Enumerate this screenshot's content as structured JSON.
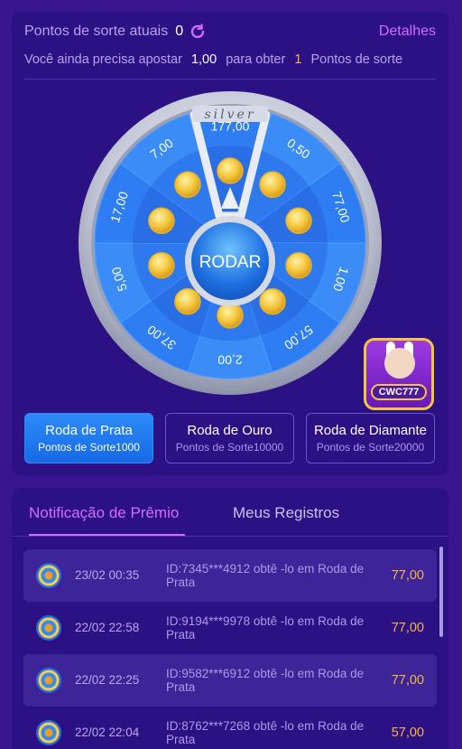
{
  "header": {
    "luck_points_label": "Pontos de sorte atuais",
    "luck_points_value": "0",
    "details_link": "Detalhes",
    "bet_prefix": "Você ainda precisa apostar",
    "bet_amount": "1,00",
    "bet_middle": "para obter",
    "points_amount": "1",
    "points_suffix": "Pontos de sorte"
  },
  "wheel": {
    "tier_label": "silver",
    "spin_label": "RODAR",
    "prizes": [
      "177,00",
      "0,50",
      "77,00",
      "1,00",
      "57,00",
      "2,00",
      "37,00",
      "5,00",
      "17,00",
      "7,00"
    ]
  },
  "logo": {
    "text": "CWC777"
  },
  "wheel_tabs": [
    {
      "title": "Roda de Prata",
      "subtitle": "Pontos de Sorte1000",
      "active": true
    },
    {
      "title": "Roda de Ouro",
      "subtitle": "Pontos de Sorte10000",
      "active": false
    },
    {
      "title": "Roda de Diamante",
      "subtitle": "Pontos de Sorte20000",
      "active": false
    }
  ],
  "records_tabs": {
    "notifications": "Notificação de Prêmio",
    "my_records": "Meus Registros"
  },
  "records": [
    {
      "time": "23/02 00:35",
      "message": "ID:7345***4912 obtê -lo em Roda de Prata",
      "amount": "77,00"
    },
    {
      "time": "22/02 22:58",
      "message": "ID:9194***9978 obtê -lo em Roda de Prata",
      "amount": "77,00"
    },
    {
      "time": "22/02 22:25",
      "message": "ID:9582***6912 obtê -lo em Roda de Prata",
      "amount": "77,00"
    },
    {
      "time": "22/02 22:04",
      "message": "ID:8762***7268 obtê -lo em Roda de Prata",
      "amount": "57,00"
    }
  ],
  "colors": {
    "background": "#3a1590",
    "card": "#2c1185",
    "accent_pink": "#d56cf6",
    "gold": "#f5b73b",
    "wheel_blue": "#2f7df2"
  }
}
